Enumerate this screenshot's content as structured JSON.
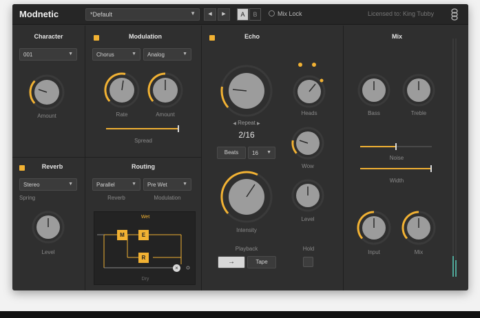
{
  "app": {
    "title": "Modnetic",
    "preset": "*Default",
    "nav_prev": "◀",
    "nav_next": "▶",
    "ab_a": "A",
    "ab_b": "B",
    "mix_lock": "Mix Lock",
    "licensed": "Licensed to: King Tubby"
  },
  "character": {
    "title": "Character",
    "model": "001",
    "amount_label": "Amount",
    "amount_value": 0.5
  },
  "modulation": {
    "title": "Modulation",
    "type": "Chorus",
    "style": "Analog",
    "rate_label": "Rate",
    "amount_label": "Amount",
    "spread_label": "Spread",
    "rate_value": 0.55,
    "amount_value": 0.5,
    "spread_value": 1.0
  },
  "echo": {
    "title": "Echo",
    "repeat_label": "Repeat",
    "repeat_value": "2/16",
    "repeat_prev": "◀",
    "repeat_next": "▶",
    "beats_label": "Beats",
    "beats_value": "16",
    "heads_label": "Heads",
    "wow_label": "Wow",
    "intensity_label": "Intensity",
    "level_label": "Level",
    "playback_label": "Playback",
    "playback_arrow": "→",
    "playback_tape": "Tape",
    "hold_label": "Hold",
    "repeat_amount": 0.45,
    "heads_amount": 0.6,
    "wow_amount": 0.3,
    "intensity_amount": 0.6,
    "level_amount": 0.5
  },
  "mix": {
    "title": "Mix",
    "bass_label": "Bass",
    "treble_label": "Treble",
    "noise_label": "Noise",
    "width_label": "Width",
    "input_label": "Input",
    "mix_label": "Mix",
    "noise_value": 0.5,
    "width_value": 1.0,
    "input_value": 0.5,
    "mix_value": 0.5
  },
  "reverb": {
    "title": "Reverb",
    "type": "Stereo",
    "spring_label": "Spring",
    "level_label": "Level"
  },
  "routing": {
    "title": "Routing",
    "mode": "Parallel",
    "order": "Pre Wet",
    "reverb_label": "Reverb",
    "modulation_label": "Modulation",
    "wet_label": "Wet",
    "dry_label": "Dry",
    "node_m": "M",
    "node_e": "E",
    "node_r": "R"
  },
  "colors": {
    "accent": "#f2b233",
    "bg": "#2f2f2f",
    "knob": "#9c9c9c"
  }
}
